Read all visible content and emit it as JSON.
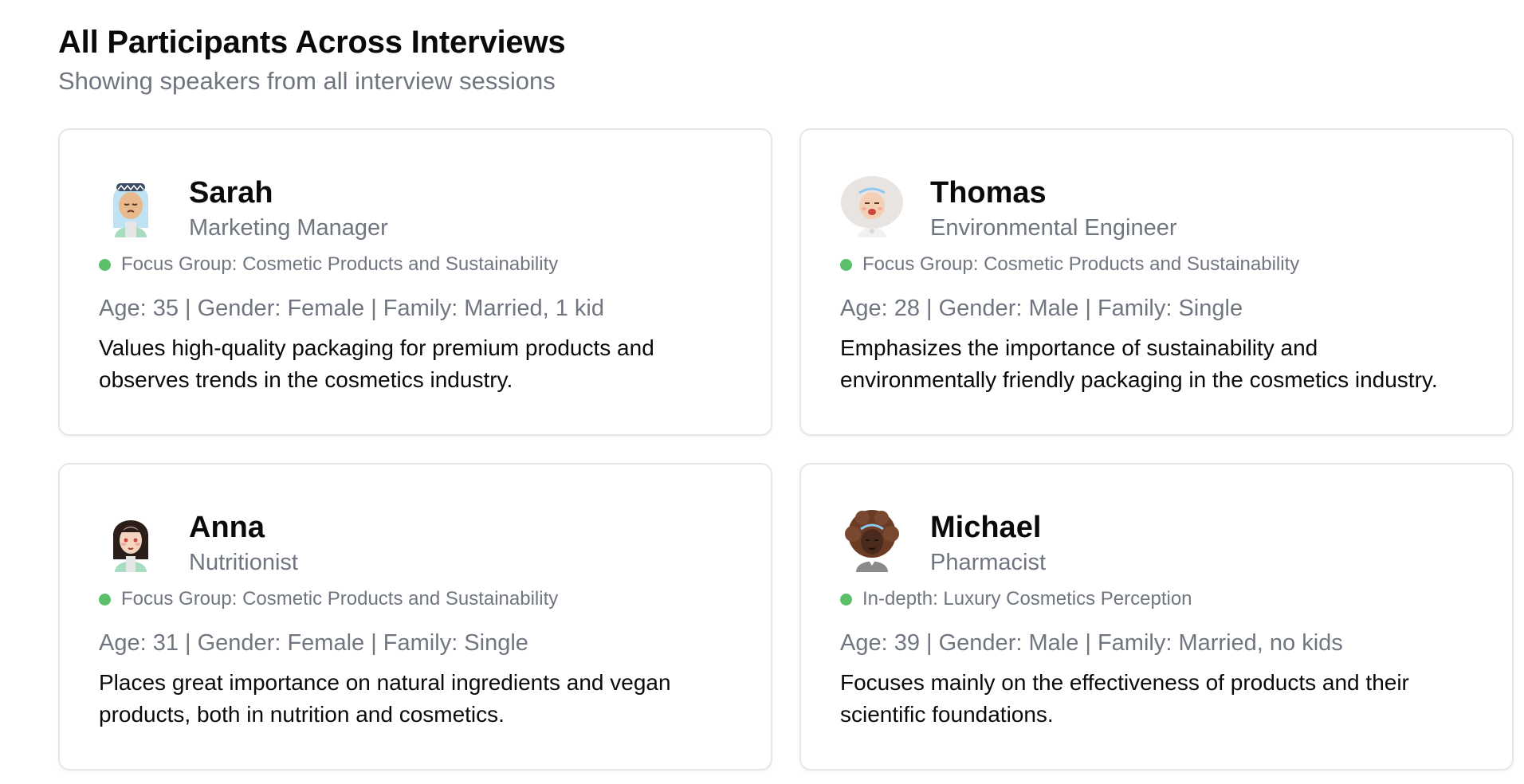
{
  "header": {
    "title": "All Participants Across Interviews",
    "subtitle": "Showing speakers from all interview sessions"
  },
  "participants": [
    {
      "name": "Sarah",
      "role": "Marketing Manager",
      "session": "Focus Group: Cosmetic Products and Sustainability",
      "demographics": "Age: 35 | Gender: Female | Family: Married, 1 kid",
      "description": "Values high-quality packaging for premium products and observes trends in the cosmetics industry.",
      "avatar_icon": "avatar-light-blue-hair-icon",
      "status_color": "#5cbf6a"
    },
    {
      "name": "Thomas",
      "role": "Environmental Engineer",
      "session": "Focus Group: Cosmetic Products and Sustainability",
      "demographics": "Age: 28 | Gender: Male | Family: Single",
      "description": "Emphasizes the importance of sustainability and environmentally friendly packaging in the cosmetics industry.",
      "avatar_icon": "avatar-gray-hair-icon",
      "status_color": "#5cbf6a"
    },
    {
      "name": "Anna",
      "role": "Nutritionist",
      "session": "Focus Group: Cosmetic Products and Sustainability",
      "demographics": "Age: 31 | Gender: Female | Family: Single",
      "description": "Places great importance on natural ingredients and vegan products, both in nutrition and cosmetics.",
      "avatar_icon": "avatar-dark-hair-icon",
      "status_color": "#5cbf6a"
    },
    {
      "name": "Michael",
      "role": "Pharmacist",
      "session": "In-depth: Luxury Cosmetics Perception",
      "demographics": "Age: 39 | Gender: Male | Family: Married, no kids",
      "description": "Focuses mainly on the effectiveness of products and their scientific foundations.",
      "avatar_icon": "avatar-curly-brown-hair-icon",
      "status_color": "#5cbf6a"
    }
  ]
}
